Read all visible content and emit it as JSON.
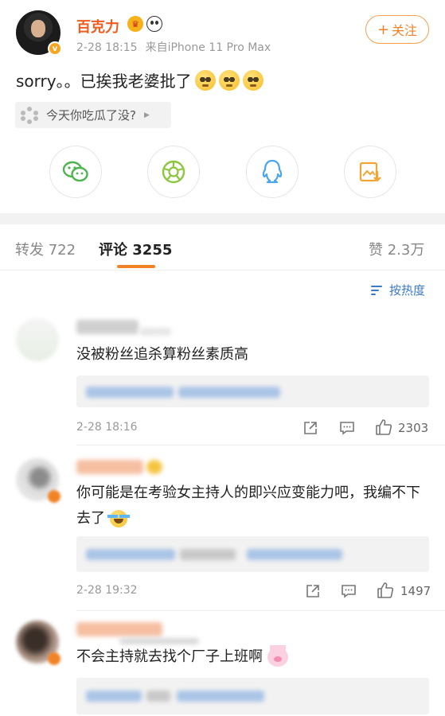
{
  "post": {
    "username": "百克力",
    "time": "2-28 18:15",
    "source": "来自iPhone 11 Pro Max",
    "follow_label": "关注",
    "text": "sorry。。已挨我老婆批了",
    "topic": "今天你吃瓜了没?",
    "share_targets": [
      "wechat-icon",
      "moments-icon",
      "qq-icon",
      "save-image-icon"
    ]
  },
  "tabs": {
    "repost": "转发 722",
    "comments": "评论 3255",
    "likes": "赞 2.3万"
  },
  "sort": {
    "label": "按热度"
  },
  "comments": [
    {
      "text": "没被粉丝追杀算粉丝素质高",
      "time": "2-28 18:16",
      "likes": "2303"
    },
    {
      "text": "你可能是在考验女主持人的即兴应变能力吧，我编不下去了",
      "time": "2-28 19:32",
      "likes": "1497"
    },
    {
      "text": "不会主持就去找个厂子上班啊"
    }
  ],
  "colors": {
    "accent": "#f28226",
    "username": "#f25a1e",
    "link": "#3c79c6"
  }
}
